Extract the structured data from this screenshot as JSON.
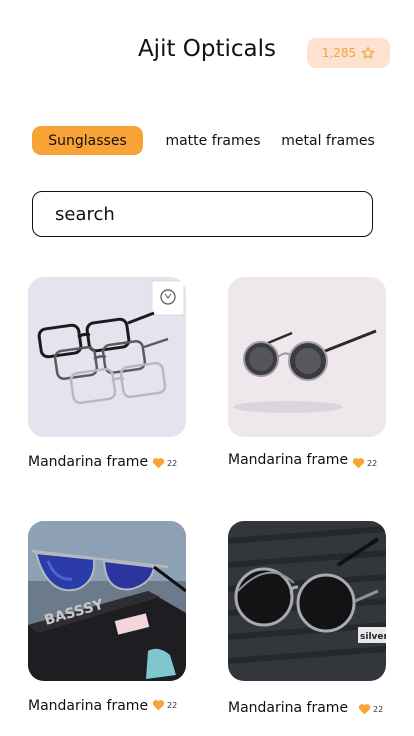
{
  "header": {
    "title": "Ajit Opticals",
    "points": "1,285",
    "points_icon": "star-outline-icon"
  },
  "tabs": [
    {
      "label": "Sunglasses",
      "active": true
    },
    {
      "label": "matte frames",
      "active": false
    },
    {
      "label": "metal frames",
      "active": false
    }
  ],
  "search": {
    "placeholder": "search",
    "value": ""
  },
  "products": [
    {
      "name": "Mandarina frame",
      "likes": "22",
      "image": "clear-eyeglass-frames-photo"
    },
    {
      "name": "Mandarina frame",
      "likes": "22",
      "image": "round-steampunk-sunglasses-photo"
    },
    {
      "name": "Mandarina frame",
      "likes": "22",
      "image": "blue-mirror-sunglasses-on-box-photo"
    },
    {
      "name": "Mandarina frame",
      "likes": "22",
      "image": "flip-up-round-sunglasses-photo"
    }
  ],
  "colors": {
    "accent": "#f9a336",
    "accent_soft": "#fde3cf",
    "heart": "#f9a336"
  }
}
